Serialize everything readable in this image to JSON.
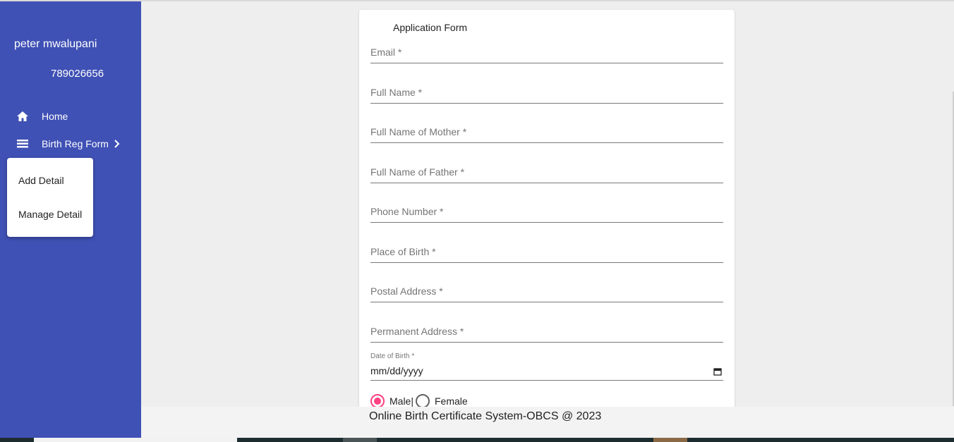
{
  "sidebar": {
    "user_name": "peter mwalupani",
    "user_phone": "789026656",
    "items": [
      {
        "label": "Home",
        "icon": "home-icon"
      },
      {
        "label": "Birth Reg Form",
        "icon": "list-icon"
      }
    ],
    "submenu": [
      {
        "label": "Add Detail"
      },
      {
        "label": "Manage Detail"
      }
    ]
  },
  "form": {
    "title": "Application Form",
    "fields": [
      {
        "label": "Email *"
      },
      {
        "label": "Full Name *"
      },
      {
        "label": "Full Name of Mother *"
      },
      {
        "label": "Full Name of Father *"
      },
      {
        "label": "Phone Number *"
      },
      {
        "label": "Place of Birth *"
      },
      {
        "label": "Postal Address *"
      },
      {
        "label": "Permanent Address *"
      }
    ],
    "date_of_birth": {
      "label": "Date of Birth *",
      "value": "mm/dd/yyyy"
    },
    "gender": {
      "options": [
        "Male|",
        "Female"
      ],
      "selected": "Male|"
    }
  },
  "footer": {
    "text": "Online Birth Certificate System-OBCS @ 2023"
  },
  "colors": {
    "sidebar": "#3f51b5",
    "accent": "#ff4081"
  }
}
